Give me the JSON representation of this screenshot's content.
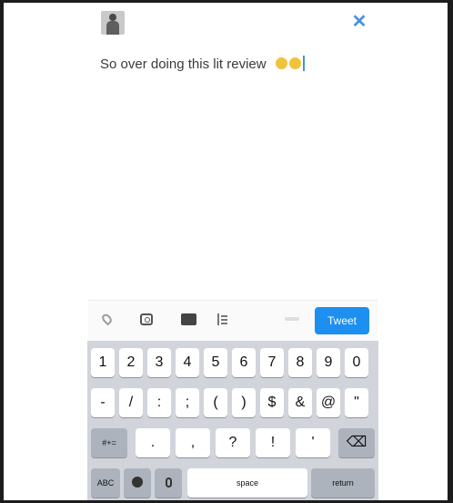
{
  "compose": {
    "text": "So over doing this lit review",
    "emojis": [
      "smiley-face-emoji",
      "smiley-face-emoji"
    ]
  },
  "header": {
    "close_icon": "close-icon",
    "avatar_icon": "avatar"
  },
  "toolbar": {
    "icons": [
      "location-icon",
      "camera-icon",
      "gif-icon",
      "poll-icon"
    ],
    "tweet_label": "Tweet"
  },
  "keyboard": {
    "row1": [
      "1",
      "2",
      "3",
      "4",
      "5",
      "6",
      "7",
      "8",
      "9",
      "0"
    ],
    "row2": [
      "-",
      "/",
      ":",
      ";",
      "(",
      ")",
      "$",
      "&",
      "@",
      "\""
    ],
    "row3": {
      "toggle": "#+=",
      "keys": [
        ".",
        ",",
        "?",
        "!",
        "'"
      ],
      "backspace": "⌫"
    },
    "row4": {
      "abc": "ABC",
      "globe": "globe-icon",
      "mic": "microphone-icon",
      "space": "space",
      "return": "return"
    }
  },
  "colors": {
    "accent": "#1d8ff0",
    "close": "#4a90e2",
    "keyboard_bg": "#d1d4db"
  }
}
